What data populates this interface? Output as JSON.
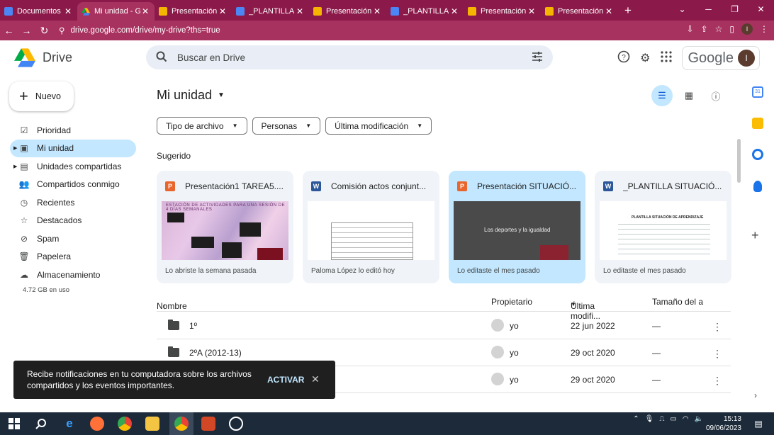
{
  "browser": {
    "tabs": [
      {
        "label": "Documentos",
        "icon": "docs-icon",
        "active": false
      },
      {
        "label": "Mi unidad - G",
        "icon": "drive-icon",
        "active": true
      },
      {
        "label": "Presentación",
        "icon": "slides-icon",
        "active": false
      },
      {
        "label": "_PLANTILLA S",
        "icon": "docs-icon",
        "active": false
      },
      {
        "label": "Presentación",
        "icon": "slides-icon",
        "active": false
      },
      {
        "label": "_PLANTILLA S",
        "icon": "docs-icon",
        "active": false
      },
      {
        "label": "Presentación",
        "icon": "slides-icon",
        "active": false
      },
      {
        "label": "Presentación",
        "icon": "slides-icon",
        "active": false
      }
    ],
    "url": "drive.google.com/drive/my-drive?ths=true",
    "profile_initial": "I"
  },
  "header": {
    "app_name": "Drive",
    "search_placeholder": "Buscar en Drive",
    "google_label": "Google",
    "avatar_initial": "I"
  },
  "sidebar": {
    "new_label": "Nuevo",
    "items": [
      {
        "label": "Prioridad",
        "icon": "priority-icon"
      },
      {
        "label": "Mi unidad",
        "icon": "my-drive-icon",
        "active": true
      },
      {
        "label": "Unidades compartidas",
        "icon": "shared-drives-icon"
      },
      {
        "label": "Compartidos conmigo",
        "icon": "shared-with-me-icon"
      },
      {
        "label": "Recientes",
        "icon": "clock-icon"
      },
      {
        "label": "Destacados",
        "icon": "star-icon"
      },
      {
        "label": "Spam",
        "icon": "spam-icon"
      },
      {
        "label": "Papelera",
        "icon": "trash-icon"
      },
      {
        "label": "Almacenamiento",
        "icon": "cloud-icon"
      }
    ],
    "storage_used": "4.72 GB en uso"
  },
  "main": {
    "title": "Mi unidad",
    "filters": [
      "Tipo de archivo",
      "Personas",
      "Última modificación"
    ],
    "suggested_label": "Sugerido",
    "cards": [
      {
        "name": "Presentación1 TAREA5....",
        "type": "ppt",
        "footer": "Lo abriste la semana pasada",
        "thumb_title": "ESTACIÓN DE ACTIVIDADES PARA UNA SESIÓN DE 4 DÍAS SEMANALES"
      },
      {
        "name": "Comisión actos conjunt...",
        "type": "word",
        "footer": "Paloma López lo editó hoy"
      },
      {
        "name": "Presentación SITUACIÓ...",
        "type": "ppt",
        "footer": "Lo editaste el mes pasado",
        "thumb_title": "Los deportes y la igualdad",
        "highlight": true
      },
      {
        "name": "_PLANTILLA SITUACIÓ...",
        "type": "word",
        "footer": "Lo editaste el mes pasado",
        "thumb_title": "PLANTILLA SITUACIÓN DE APRENDIZAJE"
      }
    ],
    "columns": {
      "name": "Nombre",
      "owner": "Propietario",
      "modified": "Última modifi...",
      "size": "Tamaño del a"
    },
    "rows": [
      {
        "name": "1º",
        "owner": "yo",
        "modified": "22 jun 2022",
        "size": "—"
      },
      {
        "name": "2ºA (2012-13)",
        "owner": "yo",
        "modified": "29 oct 2020",
        "size": "—"
      },
      {
        "name": "",
        "owner": "yo",
        "modified": "29 oct 2020",
        "size": "—"
      }
    ]
  },
  "snackbar": {
    "message": "Recibe notificaciones en tu computadora sobre los archivos compartidos y los eventos importantes.",
    "action": "ACTIVAR"
  },
  "taskbar": {
    "time": "15:13",
    "date": "09/06/2023"
  },
  "colors": {
    "browser_frame": "#8b1a4a",
    "active_blue": "#c2e7ff",
    "search_bg": "#e9eef6"
  }
}
